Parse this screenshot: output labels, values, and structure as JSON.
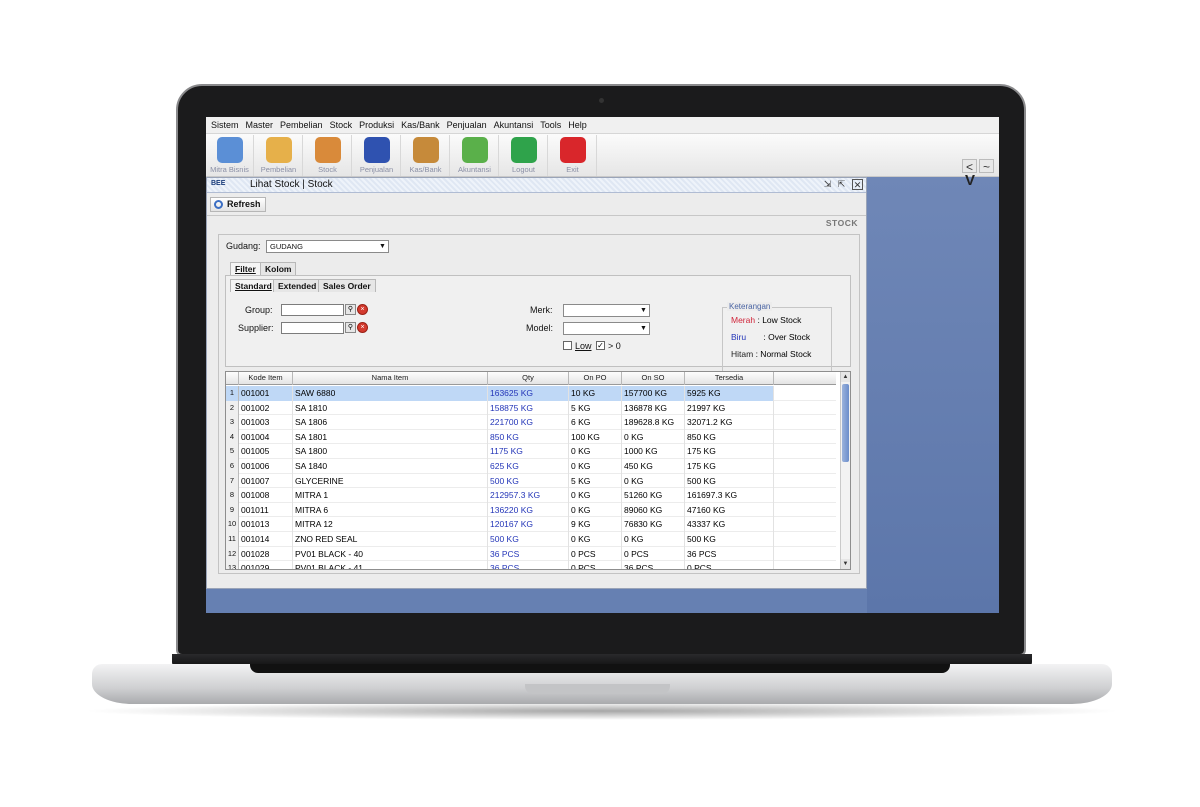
{
  "menu": [
    "Sistem",
    "Master",
    "Pembelian",
    "Stock",
    "Produksi",
    "Kas/Bank",
    "Penjualan",
    "Akuntansi",
    "Tools",
    "Help"
  ],
  "toolbar": [
    {
      "label": "Mitra Bisnis",
      "icon": "people-icon",
      "color": "#5b8fd6"
    },
    {
      "label": "Pembelian",
      "icon": "notebook-icon",
      "color": "#e6b04a"
    },
    {
      "label": "Stock",
      "icon": "box-icon",
      "color": "#d98a3a"
    },
    {
      "label": "Penjualan",
      "icon": "shopping-bag-icon",
      "color": "#2f52b0"
    },
    {
      "label": "Kas/Bank",
      "icon": "money-bag-icon",
      "color": "#c68a3a"
    },
    {
      "label": "Akuntansi",
      "icon": "chart-icon",
      "color": "#5ab04a"
    },
    {
      "label": "Logout",
      "icon": "logout-icon",
      "color": "#2fa34b"
    },
    {
      "label": "Exit",
      "icon": "power-icon",
      "color": "#d9262b"
    }
  ],
  "nav": {
    "prev": "<",
    "sep": "~",
    "v": "V"
  },
  "window": {
    "logo": "BEE",
    "title": "Lihat Stock | Stock",
    "refresh_label": "Refresh",
    "page_label": "STOCK",
    "gudang_label": "Gudang:",
    "gudang_value": "GUDANG",
    "outer_tabs": [
      "Filter",
      "Kolom"
    ],
    "inner_tabs": [
      "Standard",
      "Extended",
      "Sales Order"
    ],
    "group_label": "Group:",
    "supplier_label": "Supplier:",
    "merk_label": "Merk:",
    "model_label": "Model:",
    "low_label": "Low",
    "gt0_label": "> 0",
    "legend": {
      "title": "Keterangan",
      "rows": [
        {
          "color_name": "Merah",
          "desc": ": Low Stock",
          "color": "#d0253a"
        },
        {
          "color_name": "Biru",
          "desc": ": Over Stock",
          "color": "#2335b8"
        },
        {
          "color_name": "Hitam",
          "desc": ": Normal Stock",
          "color": "#222222"
        }
      ]
    }
  },
  "grid": {
    "headers": [
      "Kode Item",
      "Nama Item",
      "Qty",
      "On PO",
      "On SO",
      "Tersedia"
    ],
    "rows": [
      {
        "n": "1",
        "kode": "001001",
        "nama": "SAW 6880",
        "qty": "163625 KG",
        "po": "10 KG",
        "so": "157700 KG",
        "ts": "5925 KG"
      },
      {
        "n": "2",
        "kode": "001002",
        "nama": "SA 1810",
        "qty": "158875 KG",
        "po": "5 KG",
        "so": "136878 KG",
        "ts": "21997 KG"
      },
      {
        "n": "3",
        "kode": "001003",
        "nama": "SA 1806",
        "qty": "221700 KG",
        "po": "6 KG",
        "so": "189628.8 KG",
        "ts": "32071.2 KG"
      },
      {
        "n": "4",
        "kode": "001004",
        "nama": "SA 1801",
        "qty": "850 KG",
        "po": "100 KG",
        "so": "0 KG",
        "ts": "850 KG"
      },
      {
        "n": "5",
        "kode": "001005",
        "nama": "SA 1800",
        "qty": "1175 KG",
        "po": "0 KG",
        "so": "1000 KG",
        "ts": "175 KG"
      },
      {
        "n": "6",
        "kode": "001006",
        "nama": "SA 1840",
        "qty": "625 KG",
        "po": "0 KG",
        "so": "450 KG",
        "ts": "175 KG"
      },
      {
        "n": "7",
        "kode": "001007",
        "nama": "GLYCERINE",
        "qty": "500 KG",
        "po": "5 KG",
        "so": "0 KG",
        "ts": "500 KG"
      },
      {
        "n": "8",
        "kode": "001008",
        "nama": "MITRA 1",
        "qty": "212957.3 KG",
        "po": "0 KG",
        "so": "51260 KG",
        "ts": "161697.3 KG"
      },
      {
        "n": "9",
        "kode": "001011",
        "nama": "MITRA 6",
        "qty": "136220 KG",
        "po": "0 KG",
        "so": "89060 KG",
        "ts": "47160 KG"
      },
      {
        "n": "10",
        "kode": "001013",
        "nama": "MITRA 12",
        "qty": "120167 KG",
        "po": "9 KG",
        "so": "76830 KG",
        "ts": "43337 KG"
      },
      {
        "n": "11",
        "kode": "001014",
        "nama": "ZNO RED SEAL",
        "qty": "500 KG",
        "po": "0 KG",
        "so": "0 KG",
        "ts": "500 KG"
      },
      {
        "n": "12",
        "kode": "001028",
        "nama": "PV01 BLACK - 40",
        "qty": "36 PCS",
        "po": "0 PCS",
        "so": "0 PCS",
        "ts": "36 PCS"
      },
      {
        "n": "13",
        "kode": "001029",
        "nama": "PV01 BLACK - 41",
        "qty": "36 PCS",
        "po": "0 PCS",
        "so": "36 PCS",
        "ts": "0 PCS"
      }
    ]
  }
}
